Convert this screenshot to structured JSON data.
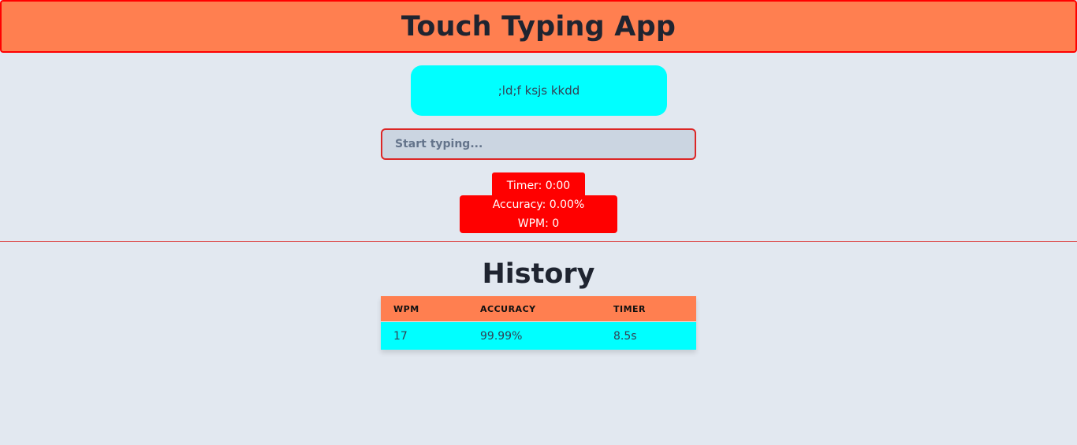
{
  "app": {
    "title": "Touch Typing App"
  },
  "prompt": {
    "text": ";ld;f ksjs kkdd"
  },
  "input": {
    "value": "",
    "placeholder": "Start typing..."
  },
  "stats": {
    "timer": "Timer: 0:00",
    "accuracy": "Accuracy: 0.00%",
    "wpm": "WPM: 0"
  },
  "history": {
    "title": "History",
    "columns": [
      "WPM",
      "ACCURACY",
      "TIMER"
    ],
    "rows": [
      {
        "wpm": "17",
        "accuracy": "99.99%",
        "timer": "8.5s"
      }
    ]
  },
  "colors": {
    "header_bg": "#ff7f50",
    "header_border": "#ff0000",
    "prompt_bg": "#00ffff",
    "stat_bg": "#ff0000",
    "page_bg": "#e2e8f0"
  }
}
